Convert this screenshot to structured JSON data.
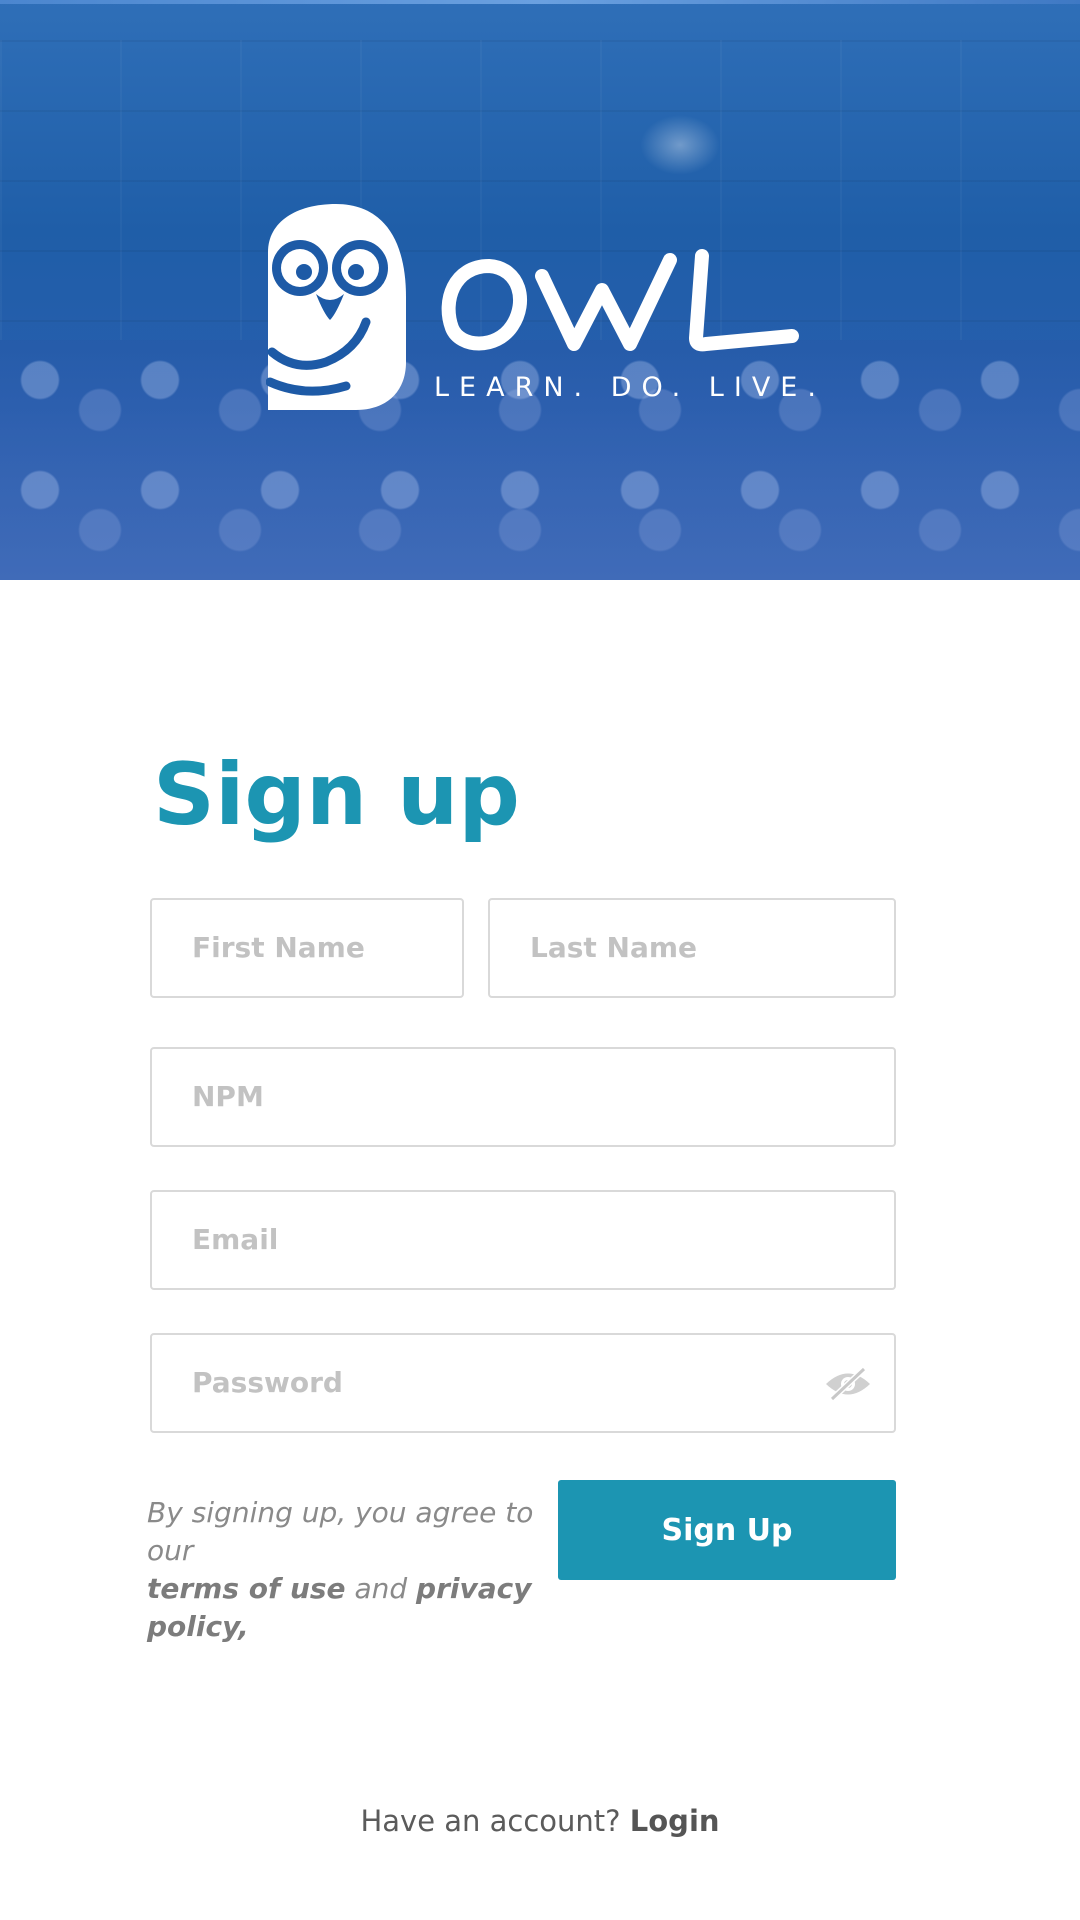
{
  "header": {
    "brand_name": "OWL",
    "tagline": "LEARN. DO. LIVE."
  },
  "form": {
    "title": "Sign up",
    "first_name": {
      "placeholder": "First Name",
      "value": ""
    },
    "last_name": {
      "placeholder": "Last Name",
      "value": ""
    },
    "npm": {
      "placeholder": "NPM",
      "value": ""
    },
    "email": {
      "placeholder": "Email",
      "value": ""
    },
    "password": {
      "placeholder": "Password",
      "value": "",
      "toggle_icon": "eye-slash-icon"
    },
    "terms": {
      "prefix": "By signing up, you agree to our",
      "terms_link": "terms of use",
      "conjunction": "and",
      "privacy_link": "privacy policy,"
    },
    "submit_label": "Sign Up"
  },
  "footer": {
    "prompt": "Have an account?",
    "login_label": "Login"
  },
  "colors": {
    "accent": "#1c95b2",
    "header_blue": "#1f5ea8",
    "owl_blue": "#1d5aa6",
    "placeholder": "#c2c2c2",
    "border": "#d9d9d9"
  }
}
